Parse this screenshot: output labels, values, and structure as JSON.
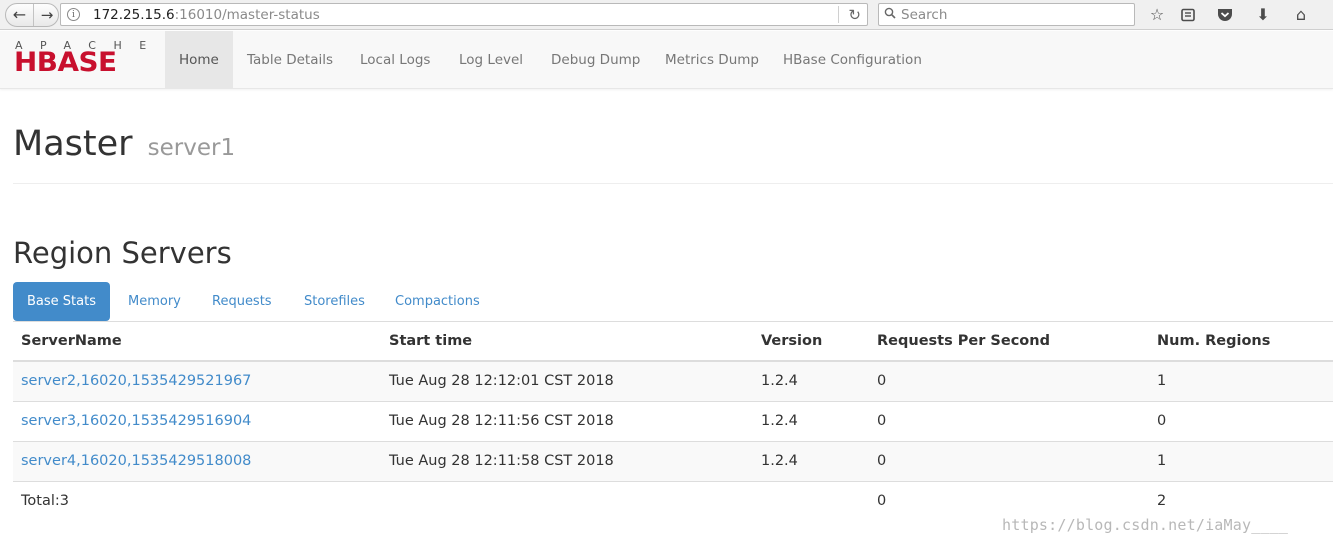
{
  "browser": {
    "url_host": "172.25.15.6",
    "url_rest": ":16010/master-status",
    "search_placeholder": "Search"
  },
  "navbar": {
    "logo_top": "APACHE",
    "logo_main": "HBASE",
    "items": [
      {
        "label": "Home",
        "active": true
      },
      {
        "label": "Table Details"
      },
      {
        "label": "Local Logs"
      },
      {
        "label": "Log Level"
      },
      {
        "label": "Debug Dump"
      },
      {
        "label": "Metrics Dump"
      },
      {
        "label": "HBase Configuration"
      }
    ]
  },
  "page": {
    "title": "Master",
    "subtitle": "server1"
  },
  "region_servers": {
    "title": "Region Servers",
    "tabs": [
      {
        "label": "Base Stats",
        "active": true
      },
      {
        "label": "Memory"
      },
      {
        "label": "Requests"
      },
      {
        "label": "Storefiles"
      },
      {
        "label": "Compactions"
      }
    ],
    "columns": [
      "ServerName",
      "Start time",
      "Version",
      "Requests Per Second",
      "Num. Regions"
    ],
    "rows": [
      {
        "server": "server2,16020,1535429521967",
        "start": "Tue Aug 28 12:12:01 CST 2018",
        "version": "1.2.4",
        "rps": "0",
        "regions": "1"
      },
      {
        "server": "server3,16020,1535429516904",
        "start": "Tue Aug 28 12:11:56 CST 2018",
        "version": "1.2.4",
        "rps": "0",
        "regions": "0"
      },
      {
        "server": "server4,16020,1535429518008",
        "start": "Tue Aug 28 12:11:58 CST 2018",
        "version": "1.2.4",
        "rps": "0",
        "regions": "1"
      }
    ],
    "total": {
      "label": "Total:3",
      "rps": "0",
      "regions": "2"
    }
  },
  "watermark": "https://blog.csdn.net/iaMay____"
}
